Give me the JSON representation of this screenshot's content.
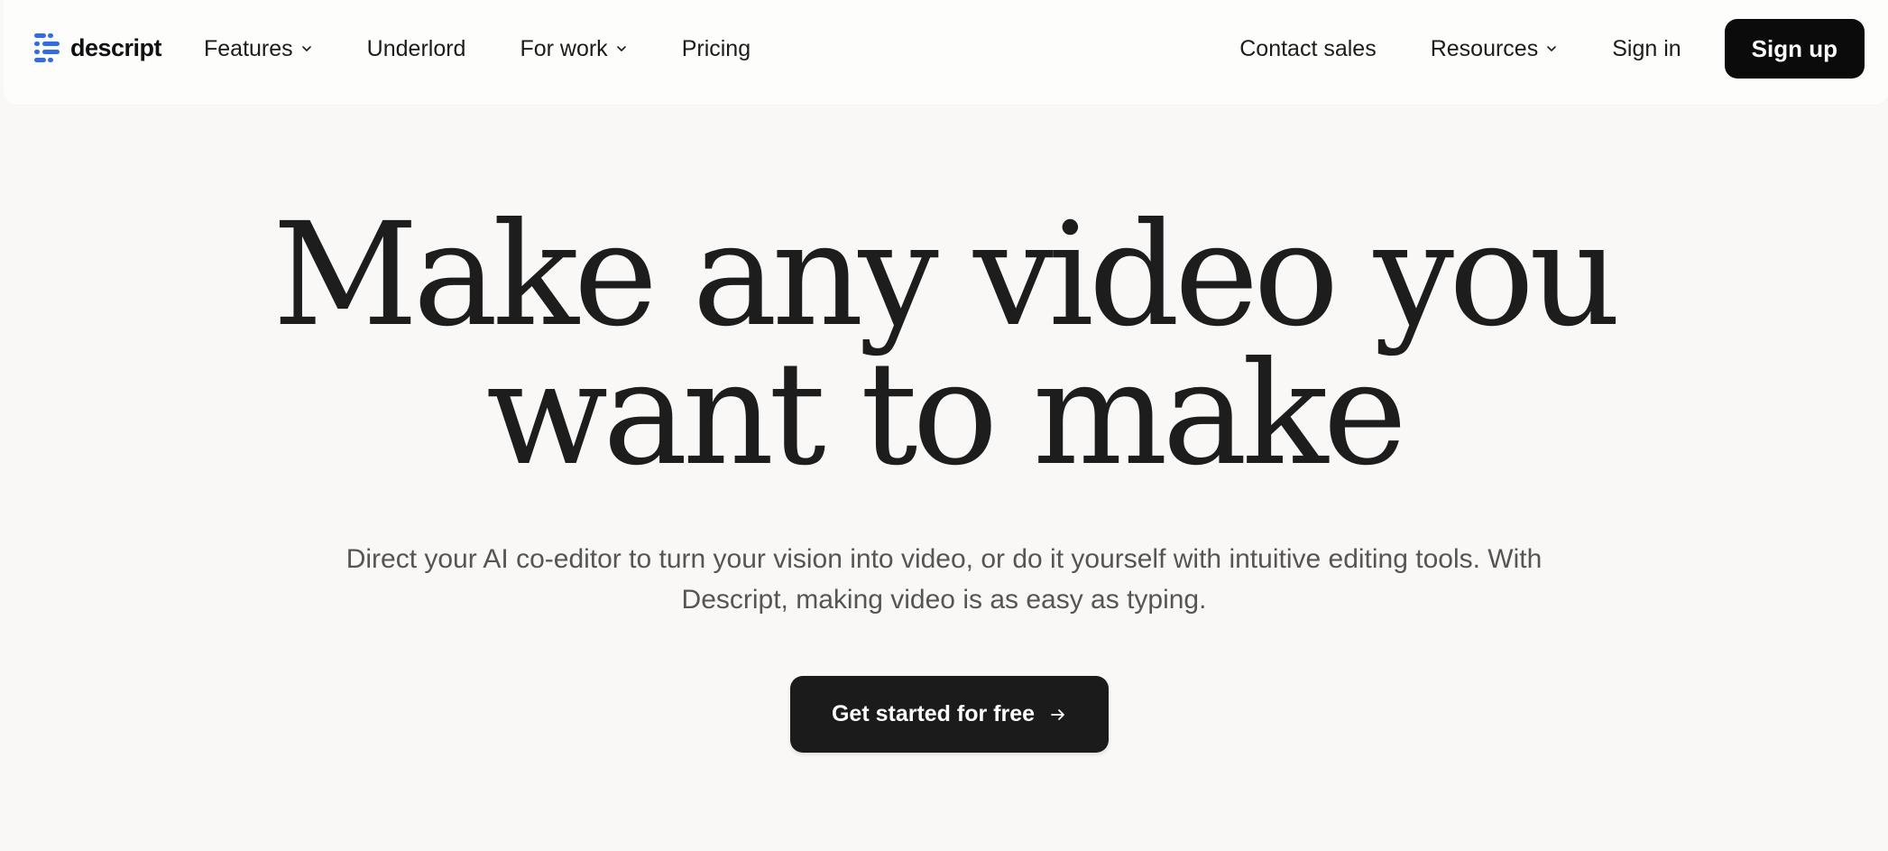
{
  "brand": {
    "name": "descript",
    "accent_color": "#2f6bf0",
    "logo_icon": "descript-logo-icon"
  },
  "nav": {
    "left_items": [
      {
        "label": "Features",
        "has_dropdown": true
      },
      {
        "label": "Underlord",
        "has_dropdown": false
      },
      {
        "label": "For work",
        "has_dropdown": true
      },
      {
        "label": "Pricing",
        "has_dropdown": false
      }
    ],
    "right_items": [
      {
        "label": "Contact sales",
        "has_dropdown": false
      },
      {
        "label": "Resources",
        "has_dropdown": true
      },
      {
        "label": "Sign in",
        "has_dropdown": false
      }
    ],
    "signup_label": "Sign up",
    "dropdown_icon": "chevron-down-icon"
  },
  "hero": {
    "title_line1": "Make any video you",
    "title_line2": "want to make",
    "subtitle_line1": "Direct your AI co-editor to turn your vision into video, or do it yourself with intuitive editing tools. With",
    "subtitle_line2": "Descript, making video is as easy as typing.",
    "cta_label": "Get started for free",
    "cta_icon": "arrow-right-icon"
  },
  "colors": {
    "background": "#f9f8f6",
    "nav_background": "#fdfdfc",
    "button_dark": "#0b0b0b",
    "cta_dark": "#1b1b1b",
    "text_primary": "#1c1c1c",
    "text_secondary": "#555555"
  }
}
